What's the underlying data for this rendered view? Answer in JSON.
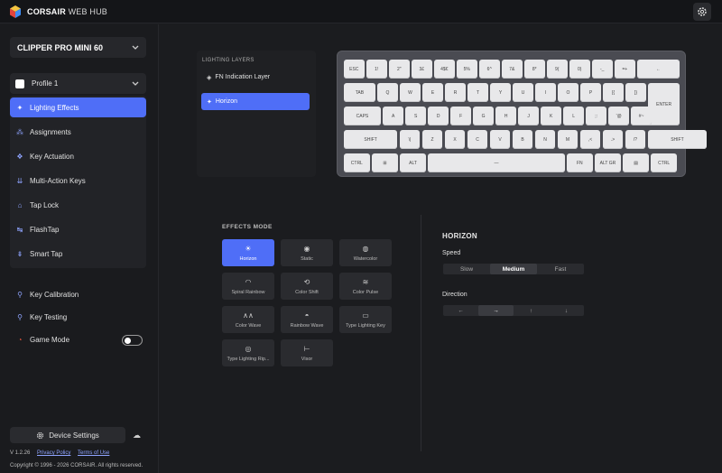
{
  "app": {
    "brand_bold": "CORSAIR",
    "brand_rest": " WEB HUB"
  },
  "sidebar": {
    "device": "CLIPPER PRO MINI 60",
    "profile": "Profile 1",
    "menu": [
      {
        "label": "Lighting Effects",
        "icon": "sparkle-icon",
        "active": true
      },
      {
        "label": "Assignments",
        "icon": "assignments-icon"
      },
      {
        "label": "Key Actuation",
        "icon": "actuation-icon"
      },
      {
        "label": "Multi-Action Keys",
        "icon": "multi-action-icon"
      },
      {
        "label": "Tap Lock",
        "icon": "tap-lock-icon"
      },
      {
        "label": "FlashTap",
        "icon": "flashtap-icon"
      },
      {
        "label": "Smart Tap",
        "icon": "smart-tap-icon"
      }
    ],
    "tools": [
      {
        "label": "Key Calibration",
        "icon": "calibration-icon"
      },
      {
        "label": "Key Testing",
        "icon": "key-testing-icon"
      },
      {
        "label": "Game Mode",
        "icon": "game-mode-icon"
      }
    ],
    "device_settings": "Device Settings",
    "version": "V 1.2.26",
    "privacy": "Privacy Policy",
    "terms": "Terms of Use",
    "copyright": "Copyright © 1996 - 2026 CORSAIR. All rights reserved."
  },
  "layers": {
    "header": "LIGHTING LAYERS",
    "items": [
      {
        "label": "FN Indication Layer",
        "active": false
      },
      {
        "label": "Horizon",
        "active": true
      }
    ]
  },
  "keyboard": {
    "rows": [
      [
        "ESC",
        "1!",
        "2\"",
        "3£",
        "4$€",
        "5%",
        "6^",
        "7&",
        "8*",
        "9(",
        "0)",
        "-_",
        "=+",
        "←"
      ],
      [
        "TAB",
        "Q",
        "W",
        "E",
        "R",
        "T",
        "Y",
        "U",
        "I",
        "O",
        "P",
        "[{",
        "]}",
        "ENTER"
      ],
      [
        "CAPS",
        "A",
        "S",
        "D",
        "F",
        "G",
        "H",
        "J",
        "K",
        "L",
        ";:",
        "'@",
        "#~"
      ],
      [
        "SHIFT",
        "\\|",
        "Z",
        "X",
        "C",
        "V",
        "B",
        "N",
        "M",
        ",<",
        ".>",
        "/?",
        "SHIFT"
      ],
      [
        "CTRL",
        "⊞",
        "ALT",
        "—",
        "FN",
        "ALT GR",
        "▤",
        "CTRL"
      ]
    ]
  },
  "effects": {
    "title": "EFFECTS MODE",
    "items": [
      {
        "label": "Horizon",
        "icon": "horizon-icon",
        "glyph": "☀",
        "active": true
      },
      {
        "label": "Static",
        "icon": "static-icon",
        "glyph": "◉"
      },
      {
        "label": "Watercolor",
        "icon": "watercolor-icon",
        "glyph": "◍"
      },
      {
        "label": "Spiral Rainbow",
        "icon": "spiral-rainbow-icon",
        "glyph": "◠"
      },
      {
        "label": "Color Shift",
        "icon": "color-shift-icon",
        "glyph": "⟲"
      },
      {
        "label": "Color Pulse",
        "icon": "color-pulse-icon",
        "glyph": "≋"
      },
      {
        "label": "Color Wave",
        "icon": "color-wave-icon",
        "glyph": "∧∧"
      },
      {
        "label": "Rainbow Wave",
        "icon": "rainbow-wave-icon",
        "glyph": "◓"
      },
      {
        "label": "Type Lighting Key",
        "icon": "type-key-icon",
        "glyph": "▭"
      },
      {
        "label": "Type Lighting Rip...",
        "icon": "type-ripple-icon",
        "glyph": "◎"
      },
      {
        "label": "Visor",
        "icon": "visor-icon",
        "glyph": "⊢"
      }
    ]
  },
  "settings": {
    "title": "HORIZON",
    "speed_label": "Speed",
    "speed_options": [
      "Slow",
      "Medium",
      "Fast"
    ],
    "speed_selected": "Medium",
    "direction_label": "Direction",
    "direction_options": [
      "←",
      "→",
      "↑",
      "↓"
    ],
    "direction_selected": "→"
  },
  "colors": {
    "accent": "#4f6ef7",
    "background": "#1b1c1f"
  }
}
